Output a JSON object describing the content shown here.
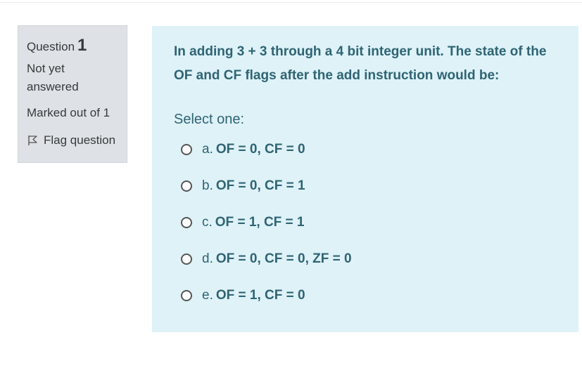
{
  "info": {
    "question_label": "Question",
    "question_number": "1",
    "state": "Not yet answered",
    "grade": "Marked out of 1",
    "flag_label": "Flag question"
  },
  "question": {
    "text": "In adding 3 + 3 through a 4 bit integer unit. The state of the OF and CF flags after the add instruction would be:",
    "prompt": "Select one:"
  },
  "options": [
    {
      "letter": "a.",
      "text": "OF = 0, CF = 0"
    },
    {
      "letter": "b.",
      "text": "OF = 0, CF = 1"
    },
    {
      "letter": "c.",
      "text": "OF = 1, CF = 1"
    },
    {
      "letter": "d.",
      "text": "OF = 0, CF = 0, ZF = 0"
    },
    {
      "letter": "e.",
      "text": "OF = 1, CF = 0"
    }
  ],
  "colors": {
    "content_bg": "#def2f8",
    "info_bg": "#dee2e6",
    "question_text": "#2f6473"
  }
}
